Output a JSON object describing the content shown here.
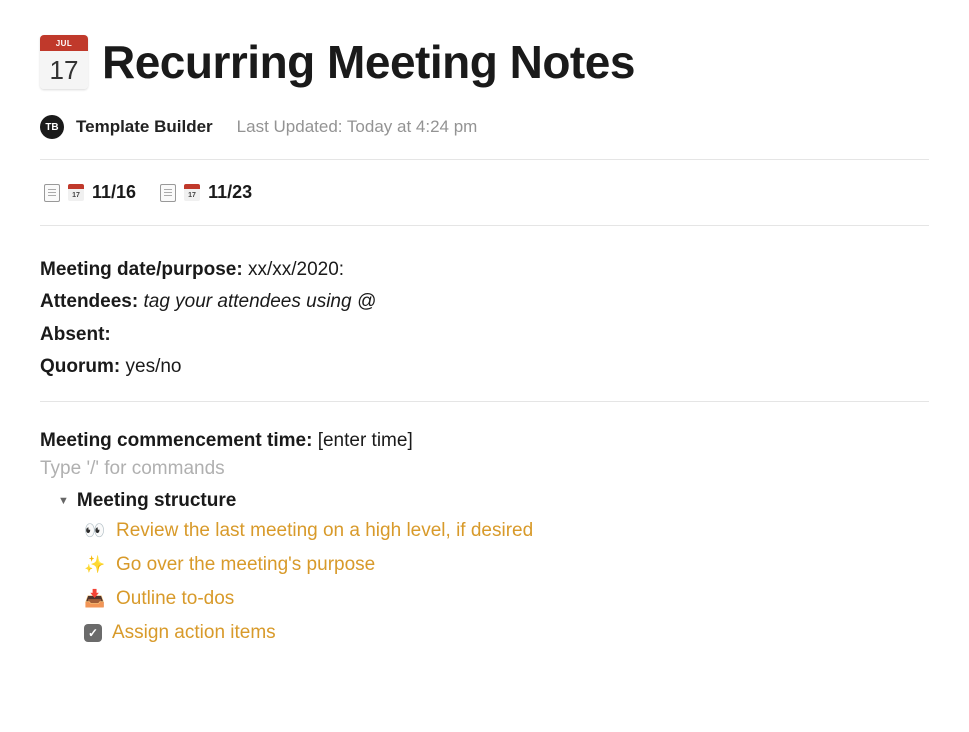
{
  "header": {
    "icon": {
      "month": "JUL",
      "day": "17"
    },
    "title": "Recurring Meeting Notes"
  },
  "meta": {
    "avatar_initials": "TB",
    "author": "Template Builder",
    "last_updated": "Last Updated: Today at 4:24 pm"
  },
  "subpages": [
    {
      "mini_day": "17",
      "label": "11/16"
    },
    {
      "mini_day": "17",
      "label": "11/23"
    }
  ],
  "info": {
    "meeting_date_label": "Meeting date/purpose:",
    "meeting_date_value": "xx/xx/2020:",
    "attendees_label": "Attendees:",
    "attendees_value": "tag your attendees using @",
    "absent_label": "Absent:",
    "absent_value": "",
    "quorum_label": "Quorum:",
    "quorum_value": "yes/no"
  },
  "commencement": {
    "label": "Meeting commencement time:",
    "value": "[enter time]",
    "placeholder": "Type '/' for commands"
  },
  "structure": {
    "heading": "Meeting structure",
    "items": [
      {
        "emoji": "👀",
        "text": "Review the last meeting on a high level, if desired"
      },
      {
        "emoji": "✨",
        "text": "Go over the meeting's purpose"
      },
      {
        "emoji": "📥",
        "text": "Outline to-dos"
      },
      {
        "emoji": "check",
        "text": "Assign action items"
      }
    ]
  }
}
